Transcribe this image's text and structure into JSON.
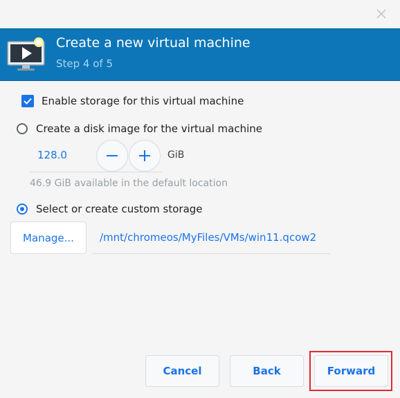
{
  "header": {
    "title": "Create a new virtual machine",
    "subtitle": "Step 4 of 5"
  },
  "storage": {
    "enable_label": "Enable storage for this virtual machine",
    "enable_checked": true,
    "disk_image_label": "Create a disk image for the virtual machine",
    "disk_image_selected": false,
    "size_value": "128.0",
    "size_unit": "GiB",
    "available_hint": "46.9 GiB available in the default location",
    "custom_label": "Select or create custom storage",
    "custom_selected": true,
    "manage_label": "Manage...",
    "path_value": "/mnt/chromeos/MyFiles/VMs/win11.qcow2"
  },
  "footer": {
    "cancel_label": "Cancel",
    "back_label": "Back",
    "forward_label": "Forward"
  },
  "colors": {
    "header_bg": "#0d76b8",
    "accent": "#1a73e8",
    "highlight": "#e0282e"
  },
  "icons": {
    "close": "close-icon",
    "vm": "virtual-machine-icon",
    "check": "checkmark-icon",
    "minus": "minus-icon",
    "plus": "plus-icon"
  }
}
